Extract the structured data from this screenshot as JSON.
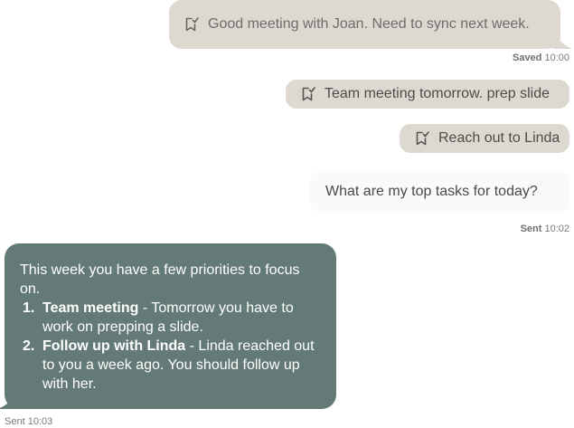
{
  "messages": {
    "saved_note_1": "Good meeting with Joan. Need to sync next week.",
    "saved_label": "Saved",
    "saved_time": "10:00",
    "saved_note_2": "Team meeting tomorrow. prep slide",
    "saved_note_3": "Reach out to Linda",
    "question": "What are my top tasks for today?",
    "sent_label": "Sent",
    "question_time": "10:02",
    "reply_time": "10:03"
  },
  "reply": {
    "intro": "This week you have a few priorities to focus on.",
    "items": [
      {
        "number": "1.",
        "heading": "Team meeting",
        "text": " - Tomorrow you have to work on prepping a slide."
      },
      {
        "number": "2.",
        "heading": "Follow up with Linda",
        "text": " - Linda reached out to you a week ago. You should follow up with her."
      }
    ]
  },
  "icons": {
    "note": "bookmark-check-icon"
  },
  "colors": {
    "saved_bubble": "#ddd9d0",
    "question_bubble": "#fafafa",
    "reply_bubble": "#647a77",
    "reply_text": "#ffffff",
    "meta_text": "#7a7a7a"
  }
}
